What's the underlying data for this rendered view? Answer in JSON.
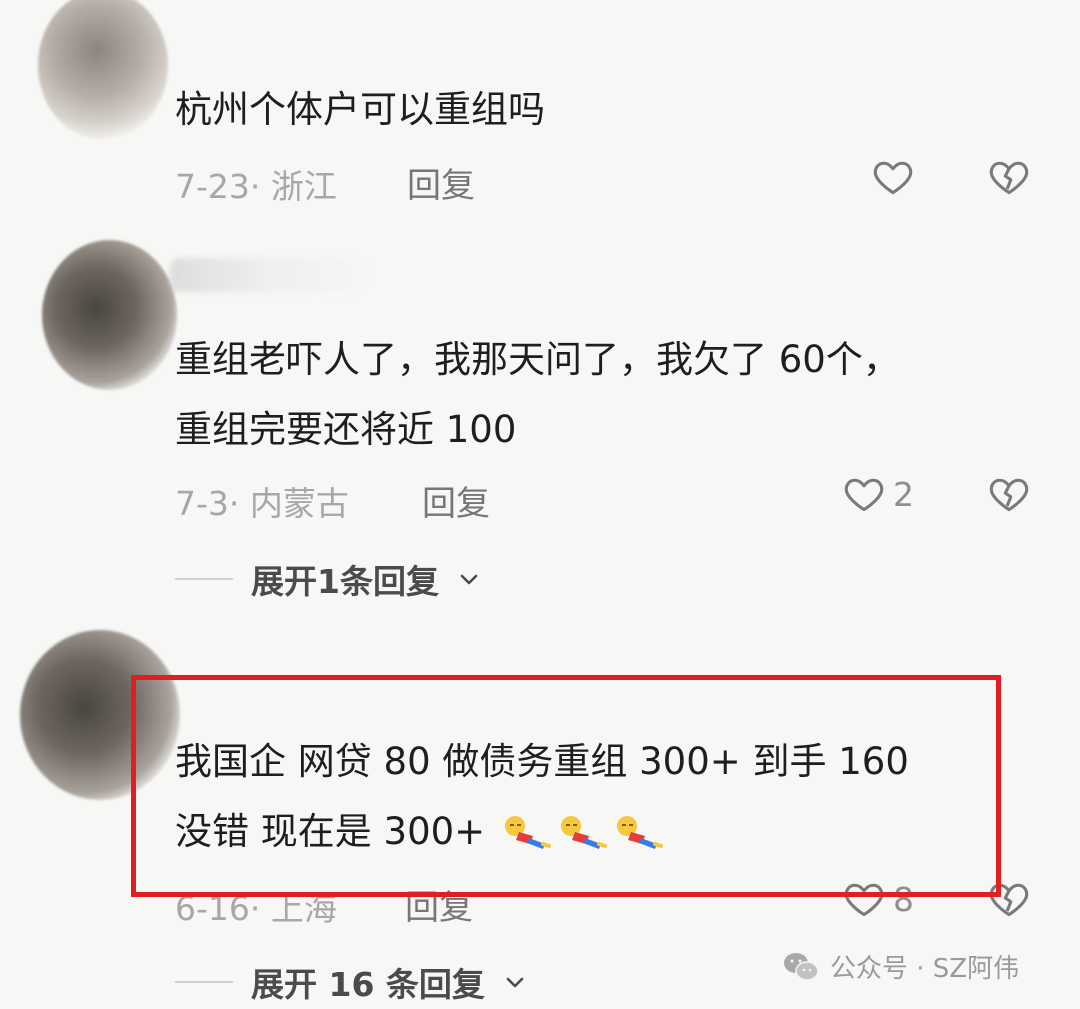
{
  "comments": [
    {
      "text_lines": [
        "杭州个体户可以重组吗"
      ],
      "date_location": "7-23· 浙江",
      "reply_label": "回复",
      "like_count": ""
    },
    {
      "text_lines": [
        "重组老吓人了，我那天问了，我欠了 60个，",
        "重组完要还将近 100"
      ],
      "date_location": "7-3· 内蒙古",
      "reply_label": "回复",
      "like_count": "2",
      "expand_label": "展开1条回复"
    },
    {
      "text_lines": [
        "我国企 网贷 80 做债务重组 300+  到手 160",
        "没错 现在是 300+"
      ],
      "emoji_count": 3,
      "date_location": "6-16· 上海",
      "reply_label": "回复",
      "like_count": "8",
      "expand_label": "展开 16 条回复"
    }
  ],
  "highlight_color": "#e02020",
  "watermark": {
    "icon": "wechat-icon",
    "text": "公众号 · SZ阿伟"
  }
}
